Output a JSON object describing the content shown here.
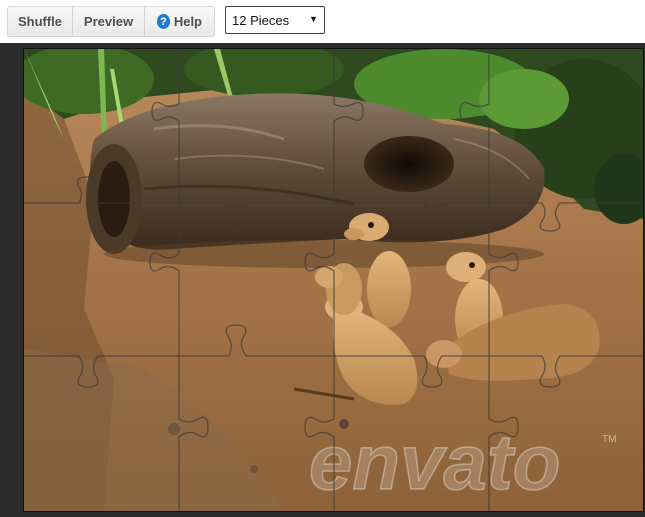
{
  "toolbar": {
    "shuffle_label": "Shuffle",
    "preview_label": "Preview",
    "help_label": "Help",
    "help_icon": "question-circle-icon"
  },
  "pieces_select": {
    "selected": "12 Pieces"
  },
  "puzzle": {
    "pieces": 12,
    "rows": 3,
    "cols": 4,
    "watermark": "envato",
    "watermark_tm": "TM"
  },
  "colors": {
    "help_icon": "#1e7ad0",
    "stage_background": "#2b2b2b"
  }
}
